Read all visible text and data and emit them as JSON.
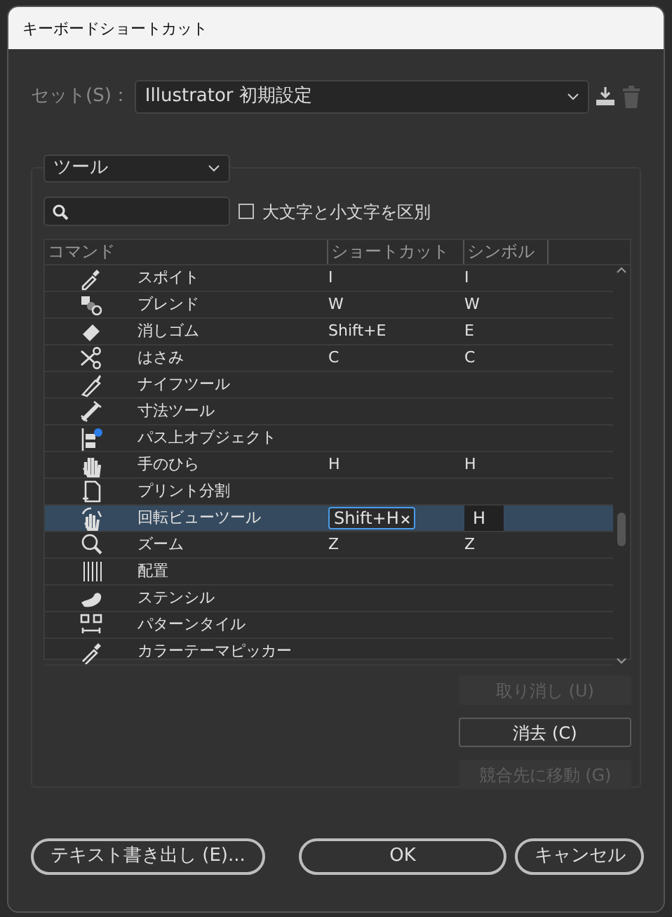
{
  "window": {
    "title": "キーボードショートカット"
  },
  "set": {
    "label": "セット(S)：",
    "value": "Illustrator 初期設定"
  },
  "category": {
    "value": "ツール"
  },
  "case_sensitive": {
    "label": "大文字と小文字を区別",
    "checked": false
  },
  "table": {
    "columns": [
      "コマンド",
      "ショートカット",
      "シンボル"
    ],
    "rows": [
      {
        "command": "スポイト",
        "shortcut": "I",
        "symbol": "I",
        "selected": false
      },
      {
        "command": "ブレンド",
        "shortcut": "W",
        "symbol": "W",
        "selected": false
      },
      {
        "command": "消しゴム",
        "shortcut": "Shift+E",
        "symbol": "E",
        "selected": false
      },
      {
        "command": "はさみ",
        "shortcut": "C",
        "symbol": "C",
        "selected": false
      },
      {
        "command": "ナイフツール",
        "selected": false
      },
      {
        "command": "寸法ツール",
        "selected": false
      },
      {
        "command": "パス上オブジェクト",
        "selected": false
      },
      {
        "command": "手のひら",
        "shortcut": "H",
        "symbol": "H",
        "selected": false
      },
      {
        "command": "プリント分割",
        "selected": false
      },
      {
        "command": "回転ビューツール",
        "shortcut": "Shift+H",
        "symbol": "H",
        "selected": true
      },
      {
        "command": "ズーム",
        "shortcut": "Z",
        "symbol": "Z",
        "selected": false
      },
      {
        "command": "配置",
        "selected": false
      },
      {
        "command": "ステンシル",
        "selected": false
      },
      {
        "command": "パターンタイル",
        "selected": false
      },
      {
        "command": "カラーテーマピッカー",
        "selected": false
      }
    ]
  },
  "side_buttons": [
    {
      "label": "取り消し (U)",
      "disabled": true
    },
    {
      "label": "消去 (C)",
      "disabled": false
    },
    {
      "label": "競合先に移動 (G)",
      "disabled": true
    }
  ],
  "footer": {
    "export": "テキスト書き出し (E)...",
    "ok": "OK",
    "cancel": "キャンセル"
  }
}
